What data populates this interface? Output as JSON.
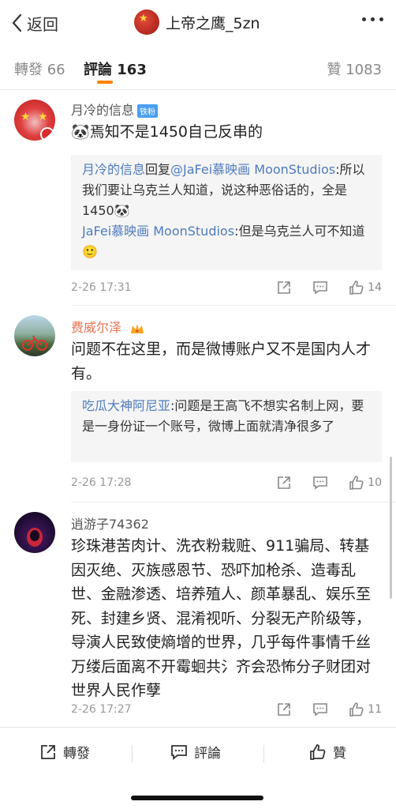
{
  "header": {
    "back_label": "返回",
    "username": "上帝之鹰_5zn"
  },
  "tabs": {
    "repost": "轉發 66",
    "comments": "評論 163",
    "likes": "贊 1083"
  },
  "comments": [
    {
      "name": "月冷的信息",
      "badge": "铁粉",
      "text": "焉知不是1450自己反串的",
      "emoji": "🐼",
      "replies": [
        {
          "user": "月冷的信息",
          "mid": "回复",
          "mention": "@JaFei慕映画 MoonStudios",
          "colon": ":",
          "text": "所以我们要让乌克兰人知道，说这种恶俗话的，全是1450🐼"
        },
        {
          "user": "JaFei慕映画 MoonStudios",
          "colon": ":",
          "text": "但是乌克兰人可不知道🙂"
        }
      ],
      "time": "2-26 17:31",
      "likes": "14"
    },
    {
      "name": "费威尔泽",
      "text": "问题不在这里，而是微博账户又不是国内人才有。",
      "replies": [
        {
          "user": "吃瓜大神阿尼亚",
          "colon": ":",
          "text": "问题是王高飞不想实名制上网，要是一身份证一个账号，微博上面就清净很多了"
        }
      ],
      "time": "2-26 17:28",
      "likes": "10"
    },
    {
      "name": "逍游子74362",
      "text": "珍珠港苦肉计、洗衣粉栽赃、911骗局、转基因灭绝、灭族感恩节、恐吓加枪杀、造毒乱世、金融渗透、培养殖人、颜革暴乱、娱乐至死、封建乡贤、混淆视听、分裂无产阶级等，导演人民致使熵增的世界，几乎每件事情千丝万缕后面离不开霉蛔共氵齐会恐怖分子财团对世界人民作孽",
      "time": "2-26 17:27",
      "likes": "11"
    }
  ],
  "bottom": {
    "repost": "轉發",
    "comment": "評論",
    "like": "贊"
  },
  "colors": {
    "accent": "#ff8200",
    "link": "#4e7bbf",
    "vip_name": "#eb7350"
  }
}
